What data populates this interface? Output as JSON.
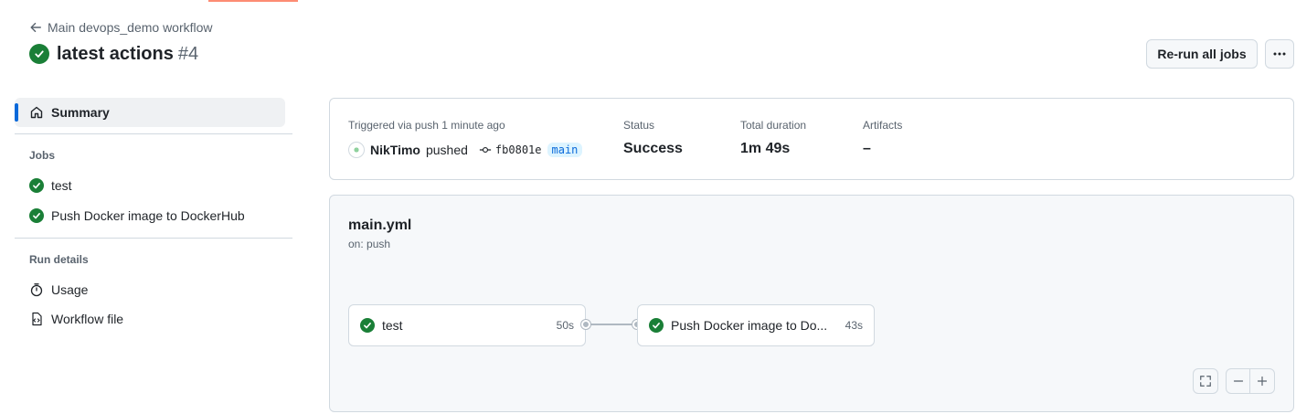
{
  "header": {
    "back_label": "Main devops_demo workflow",
    "title": "latest actions",
    "run_number": "#4",
    "rerun_label": "Re-run all jobs"
  },
  "sidebar": {
    "summary_label": "Summary",
    "jobs_heading": "Jobs",
    "jobs": [
      {
        "label": "test",
        "status": "success"
      },
      {
        "label": "Push Docker image to DockerHub",
        "status": "success"
      }
    ],
    "run_details_heading": "Run details",
    "details": [
      {
        "label": "Usage",
        "icon": "stopwatch-icon"
      },
      {
        "label": "Workflow file",
        "icon": "file-code-icon"
      }
    ]
  },
  "summary": {
    "trigger_label": "Triggered via push 1 minute ago",
    "actor": "NikTimo",
    "action": "pushed",
    "commit": "fb0801e",
    "branch": "main",
    "status_label": "Status",
    "status_value": "Success",
    "duration_label": "Total duration",
    "duration_value": "1m 49s",
    "artifacts_label": "Artifacts",
    "artifacts_value": "–"
  },
  "graph": {
    "workflow_file": "main.yml",
    "trigger": "on: push",
    "jobs": [
      {
        "name": "test",
        "duration": "50s"
      },
      {
        "name": "Push Docker image to Do...",
        "duration": "43s"
      }
    ]
  },
  "colors": {
    "success": "#1a7f37",
    "accent": "#0969da",
    "tab_underline": "#fd8c73"
  }
}
